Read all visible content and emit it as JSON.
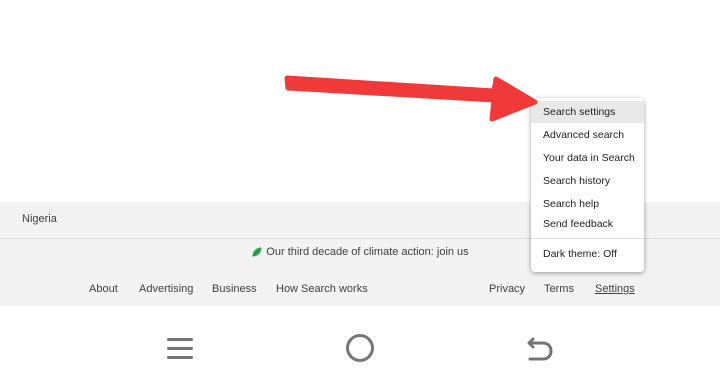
{
  "footer": {
    "country": "Nigeria",
    "climate_text": "Our third decade of climate action: join us",
    "links_left": [
      "About",
      "Advertising",
      "Business",
      "How Search works"
    ],
    "links_right": [
      "Privacy",
      "Terms",
      "Settings"
    ]
  },
  "settings_menu": {
    "items": [
      "Search settings",
      "Advanced search",
      "Your data in Search",
      "Search history",
      "Search help",
      "Send feedback",
      "Dark theme: Off"
    ],
    "highlighted_item": "Search settings"
  },
  "colors": {
    "footer_bg": "#f2f2f2",
    "menu_highlight": "#e8e8e8",
    "annotation_arrow": "#f03a3a",
    "leaf_green": "#34a853",
    "nav_icon": "#757575"
  },
  "icons": {
    "leaf": "leaf-icon",
    "annotation": "red-arrow-annotation",
    "nav_menu": "recent-apps-icon",
    "nav_home": "home-circle-icon",
    "nav_back": "back-arrow-icon"
  }
}
